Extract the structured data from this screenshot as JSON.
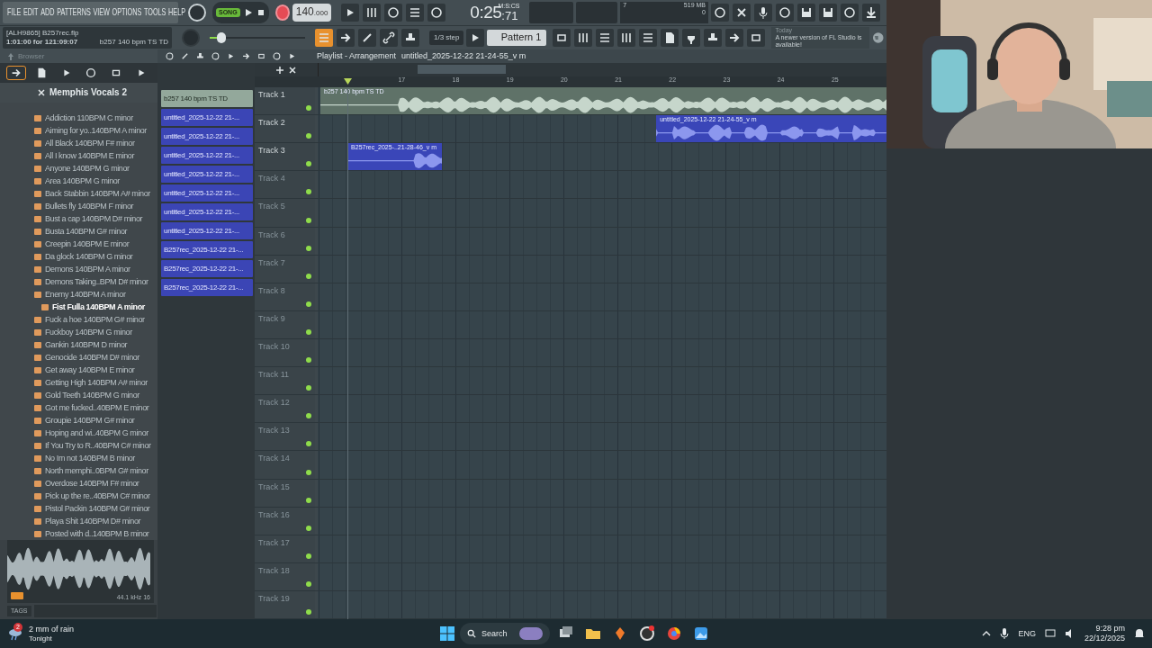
{
  "menu": [
    "FILE",
    "EDIT",
    "ADD",
    "PATTERNS",
    "VIEW",
    "OPTIONS",
    "TOOLS",
    "HELP"
  ],
  "project": {
    "file": "[ALH9865] B257rec.flp",
    "time_hint": "1:01:00 for 121:09:07",
    "hint": "b257 140 bpm TS TD"
  },
  "transport": {
    "mode": "SONG",
    "tempo": "140",
    "tempo_fraction": ".000"
  },
  "clock": {
    "time": "0:25",
    "centiseconds": ":71",
    "unit": "M:S:CS"
  },
  "monitor": {
    "cpu": "7",
    "memory": "519 MB",
    "polyphony": "0"
  },
  "master_pitch": {
    "level": 0.12
  },
  "snap": "1/3 step",
  "pattern": "Pattern 1",
  "news": {
    "date": "Today",
    "message": "A newer version of FL Studio is available!"
  },
  "browser": {
    "title": "Browser",
    "tabs": [
      {
        "selected": true
      },
      {
        "selected": false
      },
      {
        "selected": false
      },
      {
        "selected": false
      },
      {
        "selected": false
      },
      {
        "selected": false
      }
    ],
    "folder": "Memphis Vocals 2",
    "items": [
      {
        "label": "Addiction 110BPM C minor",
        "selected": false
      },
      {
        "label": "Aiming for yo..140BPM A minor",
        "selected": false
      },
      {
        "label": "All Black 140BPM F# minor",
        "selected": false
      },
      {
        "label": "All I know 140BPM E minor",
        "selected": false
      },
      {
        "label": "Anyone 140BPM G minor",
        "selected": false
      },
      {
        "label": "Area 140BPM G minor",
        "selected": false
      },
      {
        "label": "Back Stabbin 140BPM A# minor",
        "selected": false
      },
      {
        "label": "Bullets fly 140BPM F minor",
        "selected": false
      },
      {
        "label": "Bust a cap 140BPM D# minor",
        "selected": false
      },
      {
        "label": "Busta 140BPM G# minor",
        "selected": false
      },
      {
        "label": "Creepin 140BPM E minor",
        "selected": false
      },
      {
        "label": "Da glock 140BPM G minor",
        "selected": false
      },
      {
        "label": "Demons 140BPM A minor",
        "selected": false
      },
      {
        "label": "Demons Taking..BPM D# minor",
        "selected": false
      },
      {
        "label": "Enemy 140BPM A minor",
        "selected": false
      },
      {
        "label": "Fist Fulla 140BPM A minor",
        "selected": true
      },
      {
        "label": "Fuck a hoe 140BPM G# minor",
        "selected": false
      },
      {
        "label": "Fuckboy 140BPM G minor",
        "selected": false
      },
      {
        "label": "Gankin 140BPM D minor",
        "selected": false
      },
      {
        "label": "Genocide 140BPM D# minor",
        "selected": false
      },
      {
        "label": "Get away 140BPM E minor",
        "selected": false
      },
      {
        "label": "Getting High 140BPM A# minor",
        "selected": false
      },
      {
        "label": "Gold Teeth 140BPM G minor",
        "selected": false
      },
      {
        "label": "Got me fucked..40BPM E minor",
        "selected": false
      },
      {
        "label": "Groupie 140BPM G# minor",
        "selected": false
      },
      {
        "label": "Hoping and wi..40BPM G minor",
        "selected": false
      },
      {
        "label": "If You Try to R..40BPM C# minor",
        "selected": false
      },
      {
        "label": "No Im not 140BPM B minor",
        "selected": false
      },
      {
        "label": "North memphi..0BPM G# minor",
        "selected": false
      },
      {
        "label": "Overdose 140BPM F# minor",
        "selected": false
      },
      {
        "label": "Pick up the re..40BPM C# minor",
        "selected": false
      },
      {
        "label": "Pistol Packin 140BPM G# minor",
        "selected": false
      },
      {
        "label": "Playa Shit 140BPM D# minor",
        "selected": false
      },
      {
        "label": "Posted with d..140BPM B minor",
        "selected": false
      }
    ],
    "sample_info": "44.1 kHz 16",
    "tags": "TAGS"
  },
  "clips": [
    {
      "label": "b257 140 bpm TS TD",
      "color": "#93a89b"
    },
    {
      "label": "untitled_2025-12-22 21-...",
      "color": "#3b45b5"
    },
    {
      "label": "untitled_2025-12-22 21-...",
      "color": "#3b45b5"
    },
    {
      "label": "untitled_2025-12-22 21-...",
      "color": "#3b45b5"
    },
    {
      "label": "untitled_2025-12-22 21-...",
      "color": "#3b45b5"
    },
    {
      "label": "untitled_2025-12-22 21-...",
      "color": "#3b45b5"
    },
    {
      "label": "untitled_2025-12-22 21-...",
      "color": "#3b45b5"
    },
    {
      "label": "untitled_2025-12-22 21-...",
      "color": "#3b45b5"
    },
    {
      "label": "B257rec_2025-12-22 21-...",
      "color": "#3b45b5"
    },
    {
      "label": "B257rec_2025-12-22 21-...",
      "color": "#3b45b5"
    },
    {
      "label": "B257rec_2025-12-22 21-...",
      "color": "#3b45b5"
    }
  ],
  "playlist": {
    "title": "Playlist - Arrangement",
    "breadcrumb": "untitled_2025-12-22 21-24-55_v m",
    "bars": [
      "17",
      "18",
      "19",
      "20",
      "21",
      "22",
      "23",
      "24",
      "25"
    ],
    "tracks": [
      {
        "name": "Track 1",
        "empty": false,
        "clips": [
          {
            "label": "b257 140 bpm TS TD",
            "color": "#5f7268"
          }
        ]
      },
      {
        "name": "Track 2",
        "empty": false,
        "clips": [
          {
            "label": "untitled_2025-12-22 21-24-55_v m",
            "color": "#3a46b8"
          }
        ]
      },
      {
        "name": "Track 3",
        "empty": false,
        "clips": [
          {
            "label": "B257rec_2025-..21-28-46_v m",
            "color": "#3a46b8"
          }
        ]
      },
      {
        "name": "Track 4",
        "empty": true
      },
      {
        "name": "Track 5",
        "empty": true
      },
      {
        "name": "Track 6",
        "empty": true
      },
      {
        "name": "Track 7",
        "empty": true
      },
      {
        "name": "Track 8",
        "empty": true
      },
      {
        "name": "Track 9",
        "empty": true
      },
      {
        "name": "Track 10",
        "empty": true
      },
      {
        "name": "Track 11",
        "empty": true
      },
      {
        "name": "Track 12",
        "empty": true
      },
      {
        "name": "Track 13",
        "empty": true
      },
      {
        "name": "Track 14",
        "empty": true
      },
      {
        "name": "Track 15",
        "empty": true
      },
      {
        "name": "Track 16",
        "empty": true
      },
      {
        "name": "Track 17",
        "empty": true
      },
      {
        "name": "Track 18",
        "empty": true
      },
      {
        "name": "Track 19",
        "empty": true
      }
    ]
  },
  "webcam": {
    "kind": "picture"
  },
  "taskbar": {
    "weather": "2 mm of rain",
    "weather_sub": "Tonight",
    "weather_badge": "2",
    "search": "Search",
    "language": "ENG",
    "time": "9:28 pm",
    "date": "22/12/2025"
  }
}
